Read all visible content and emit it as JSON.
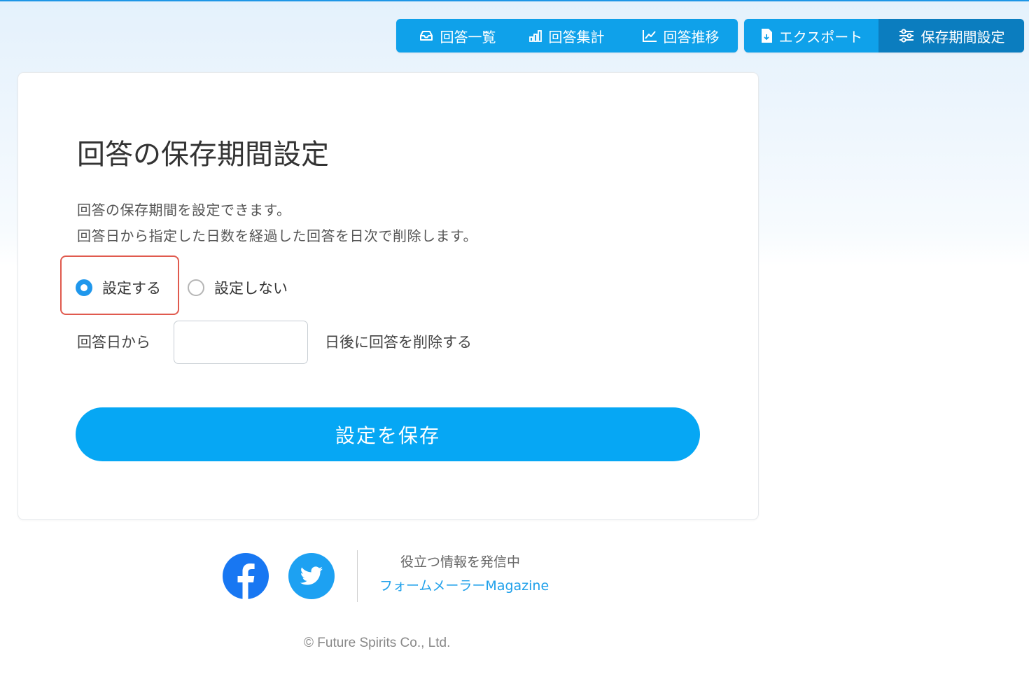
{
  "nav": {
    "group1": [
      {
        "label": "回答一覧",
        "icon": "inbox-icon"
      },
      {
        "label": "回答集計",
        "icon": "bar-chart-icon"
      },
      {
        "label": "回答推移",
        "icon": "line-chart-icon"
      }
    ],
    "group2": [
      {
        "label": "エクスポート",
        "icon": "file-export-icon"
      },
      {
        "label": "保存期間設定",
        "icon": "sliders-icon",
        "active": true
      }
    ]
  },
  "card": {
    "title": "回答の保存期間設定",
    "description": [
      "回答の保存期間を設定できます。",
      "回答日から指定した日数を経過した回答を日次で削除します。"
    ],
    "options": [
      {
        "label": "設定する",
        "checked": true
      },
      {
        "label": "設定しない",
        "checked": false
      }
    ],
    "days_prefix": "回答日から",
    "days_value": "",
    "days_suffix": "日後に回答を削除する",
    "save_label": "設定を保存"
  },
  "footer": {
    "tagline": "役立つ情報を発信中",
    "magazine": "フォームメーラーMagazine",
    "copyright": "© Future Spirits Co., Ltd."
  },
  "colors": {
    "accent": "#0fa1ea",
    "nav_active": "#0b7dbf",
    "save_button": "#06a7f4",
    "highlight": "#e05a4e",
    "facebook": "#1877f2",
    "twitter": "#1da1f2"
  }
}
